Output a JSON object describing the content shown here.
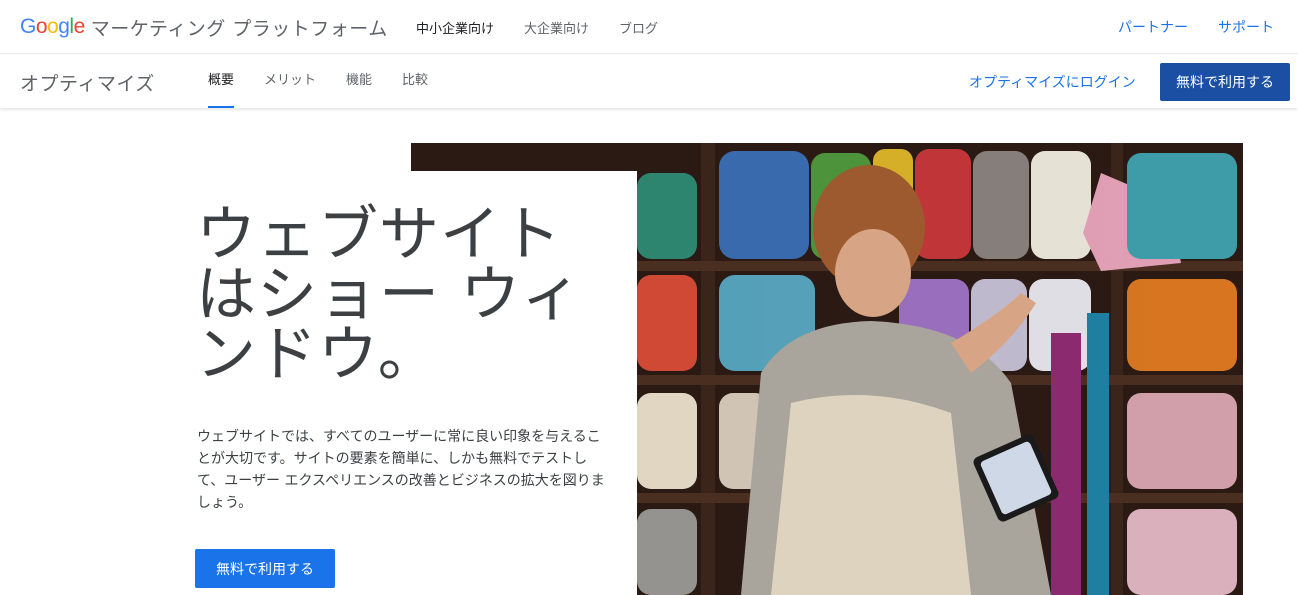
{
  "topbar": {
    "logo_letters": [
      "G",
      "o",
      "o",
      "g",
      "l",
      "e"
    ],
    "logo_colors": [
      "#4285f4",
      "#ea4335",
      "#fbbc05",
      "#4285f4",
      "#34a853",
      "#ea4335"
    ],
    "brand_name": "マーケティング プラットフォーム",
    "nav": [
      "中小企業向け",
      "大企業向け",
      "ブログ"
    ],
    "right_links": [
      "パートナー",
      "サポート"
    ]
  },
  "productbar": {
    "product_name": "オプティマイズ",
    "tabs": [
      "概要",
      "メリット",
      "機能",
      "比較"
    ],
    "login_label": "オプティマイズにログイン",
    "cta_label": "無料で利用する"
  },
  "hero": {
    "title_lines": [
      "ウェブサイト",
      "はショー ウィ",
      "ンドウ。"
    ],
    "description": "ウェブサイトでは、すべてのユーザーに常に良い印象を与えることが大切です。サイトの要素を簡単に、しかも無料でテストして、ユーザー エクスペリエンスの改善とビジネスの拡大を図りましょう。",
    "cta_label": "無料で利用する"
  },
  "colors": {
    "accent": "#1a73e8",
    "cta_dark": "#1a4fa3",
    "text": "#3c4043"
  }
}
